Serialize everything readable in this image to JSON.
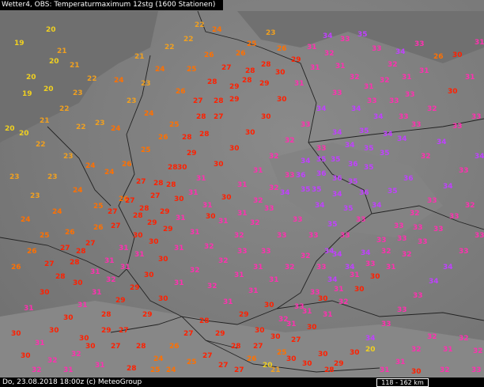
{
  "header": {
    "title": "Wetter4, OBS: Temperaturmaximum 12stg (1600 Stationen)"
  },
  "footer": {
    "timestamp": "Do, 23.08.2018 18:00z (c) MeteoGroup",
    "scale": "118 - 162 km"
  },
  "colors": {
    "temp_19_20": "#f0d020",
    "temp_21_23": "#f0a020",
    "temp_24_26": "#ff7000",
    "temp_27_30": "#ff2000",
    "temp_31_33": "#ff30b0",
    "temp_34_36": "#c040ff",
    "border": "#222222",
    "background": "#7a7a7a"
  },
  "stations": [
    [
      27,
      10,
      19
    ],
    [
      58,
      40,
      20
    ],
    [
      18,
      57,
      19
    ],
    [
      62,
      80,
      20
    ],
    [
      33,
      100,
      20
    ],
    [
      28,
      121,
      19
    ],
    [
      55,
      115,
      20
    ],
    [
      6,
      165,
      20
    ],
    [
      24,
      171,
      20
    ],
    [
      72,
      67,
      21
    ],
    [
      88,
      85,
      21
    ],
    [
      110,
      102,
      22
    ],
    [
      92,
      120,
      23
    ],
    [
      75,
      140,
      22
    ],
    [
      50,
      155,
      21
    ],
    [
      96,
      163,
      22
    ],
    [
      120,
      158,
      23
    ],
    [
      140,
      165,
      24
    ],
    [
      45,
      185,
      22
    ],
    [
      80,
      200,
      23
    ],
    [
      60,
      226,
      23
    ],
    [
      108,
      212,
      24
    ],
    [
      132,
      220,
      24
    ],
    [
      92,
      243,
      24
    ],
    [
      38,
      250,
      23
    ],
    [
      66,
      270,
      24
    ],
    [
      118,
      263,
      25
    ],
    [
      150,
      254,
      26
    ],
    [
      12,
      226,
      23
    ],
    [
      26,
      280,
      24
    ],
    [
      50,
      300,
      25
    ],
    [
      82,
      296,
      26
    ],
    [
      108,
      310,
      27
    ],
    [
      140,
      288,
      27
    ],
    [
      168,
      275,
      28
    ],
    [
      190,
      250,
      27
    ],
    [
      210,
      236,
      28
    ],
    [
      172,
      232,
      27
    ],
    [
      154,
      210,
      26
    ],
    [
      178,
      192,
      25
    ],
    [
      200,
      176,
      26
    ],
    [
      214,
      160,
      25
    ],
    [
      182,
      146,
      24
    ],
    [
      160,
      130,
      23
    ],
    [
      144,
      104,
      24
    ],
    [
      178,
      108,
      23
    ],
    [
      196,
      90,
      24
    ],
    [
      170,
      74,
      21
    ],
    [
      208,
      62,
      22
    ],
    [
      232,
      52,
      22
    ],
    [
      246,
      34,
      22
    ],
    [
      268,
      40,
      24
    ],
    [
      258,
      72,
      26
    ],
    [
      236,
      90,
      25
    ],
    [
      222,
      118,
      26
    ],
    [
      244,
      130,
      27
    ],
    [
      262,
      106,
      28
    ],
    [
      280,
      88,
      27
    ],
    [
      298,
      70,
      26
    ],
    [
      312,
      58,
      25
    ],
    [
      336,
      44,
      23
    ],
    [
      350,
      64,
      26
    ],
    [
      330,
      84,
      28
    ],
    [
      306,
      104,
      28
    ],
    [
      290,
      128,
      29
    ],
    [
      270,
      150,
      27
    ],
    [
      252,
      172,
      28
    ],
    [
      236,
      196,
      29
    ],
    [
      224,
      214,
      30
    ],
    [
      248,
      228,
      31
    ],
    [
      270,
      210,
      30
    ],
    [
      290,
      190,
      30
    ],
    [
      310,
      170,
      30
    ],
    [
      330,
      150,
      30
    ],
    [
      350,
      128,
      30
    ],
    [
      372,
      108,
      31
    ],
    [
      392,
      88,
      31
    ],
    [
      410,
      70,
      32
    ],
    [
      430,
      52,
      33
    ],
    [
      452,
      46,
      35
    ],
    [
      470,
      64,
      33
    ],
    [
      490,
      84,
      32
    ],
    [
      508,
      100,
      31
    ],
    [
      530,
      92,
      31
    ],
    [
      548,
      74,
      26
    ],
    [
      572,
      72,
      30
    ],
    [
      600,
      56,
      31
    ],
    [
      588,
      100,
      31
    ],
    [
      566,
      118,
      30
    ],
    [
      540,
      140,
      32
    ],
    [
      520,
      160,
      33
    ],
    [
      502,
      178,
      34
    ],
    [
      480,
      196,
      35
    ],
    [
      460,
      214,
      35
    ],
    [
      440,
      232,
      35
    ],
    [
      420,
      248,
      34
    ],
    [
      398,
      262,
      34
    ],
    [
      380,
      242,
      35
    ],
    [
      400,
      222,
      36
    ],
    [
      418,
      204,
      35
    ],
    [
      436,
      186,
      34
    ],
    [
      454,
      168,
      35
    ],
    [
      472,
      150,
      34
    ],
    [
      492,
      130,
      33
    ],
    [
      512,
      122,
      33
    ],
    [
      532,
      200,
      32
    ],
    [
      552,
      182,
      34
    ],
    [
      572,
      162,
      33
    ],
    [
      596,
      150,
      33
    ],
    [
      600,
      200,
      34
    ],
    [
      580,
      218,
      33
    ],
    [
      560,
      238,
      34
    ],
    [
      540,
      256,
      33
    ],
    [
      518,
      272,
      32
    ],
    [
      498,
      288,
      33
    ],
    [
      476,
      306,
      33
    ],
    [
      456,
      322,
      34
    ],
    [
      436,
      340,
      34
    ],
    [
      414,
      356,
      34
    ],
    [
      392,
      372,
      33
    ],
    [
      372,
      390,
      33
    ],
    [
      352,
      406,
      32
    ],
    [
      334,
      388,
      30
    ],
    [
      314,
      370,
      31
    ],
    [
      296,
      350,
      31
    ],
    [
      276,
      332,
      32
    ],
    [
      258,
      314,
      32
    ],
    [
      240,
      296,
      31
    ],
    [
      222,
      278,
      31
    ],
    [
      206,
      292,
      29
    ],
    [
      188,
      308,
      30
    ],
    [
      170,
      324,
      31
    ],
    [
      152,
      340,
      31
    ],
    [
      134,
      356,
      32
    ],
    [
      116,
      372,
      31
    ],
    [
      98,
      388,
      31
    ],
    [
      80,
      404,
      30
    ],
    [
      62,
      420,
      30
    ],
    [
      44,
      436,
      31
    ],
    [
      26,
      452,
      30
    ],
    [
      14,
      424,
      30
    ],
    [
      30,
      392,
      31
    ],
    [
      50,
      372,
      30
    ],
    [
      70,
      352,
      28
    ],
    [
      88,
      334,
      28
    ],
    [
      14,
      340,
      26
    ],
    [
      34,
      320,
      26
    ],
    [
      56,
      336,
      27
    ],
    [
      92,
      360,
      30
    ],
    [
      128,
      400,
      28
    ],
    [
      150,
      420,
      27
    ],
    [
      172,
      440,
      28
    ],
    [
      194,
      456,
      24
    ],
    [
      214,
      440,
      26
    ],
    [
      232,
      424,
      27
    ],
    [
      252,
      408,
      28
    ],
    [
      272,
      424,
      29
    ],
    [
      292,
      440,
      28
    ],
    [
      312,
      456,
      26
    ],
    [
      332,
      464,
      20
    ],
    [
      350,
      448,
      25
    ],
    [
      368,
      432,
      27
    ],
    [
      388,
      416,
      30
    ],
    [
      408,
      400,
      31
    ],
    [
      428,
      384,
      32
    ],
    [
      448,
      368,
      30
    ],
    [
      468,
      352,
      30
    ],
    [
      488,
      340,
      31
    ],
    [
      508,
      324,
      32
    ],
    [
      528,
      308,
      33
    ],
    [
      548,
      292,
      33
    ],
    [
      568,
      276,
      33
    ],
    [
      588,
      262,
      32
    ],
    [
      600,
      300,
      33
    ],
    [
      580,
      320,
      33
    ],
    [
      560,
      340,
      34
    ],
    [
      542,
      358,
      34
    ],
    [
      522,
      376,
      33
    ],
    [
      502,
      394,
      33
    ],
    [
      482,
      412,
      33
    ],
    [
      462,
      430,
      34
    ],
    [
      442,
      448,
      30
    ],
    [
      422,
      462,
      29
    ],
    [
      402,
      450,
      30
    ],
    [
      382,
      462,
      30
    ],
    [
      362,
      456,
      30
    ],
    [
      462,
      444,
      20
    ],
    [
      500,
      460,
      31
    ],
    [
      520,
      444,
      32
    ],
    [
      540,
      428,
      32
    ],
    [
      560,
      444,
      31
    ],
    [
      580,
      430,
      32
    ],
    [
      598,
      446,
      32
    ],
    [
      596,
      470,
      33
    ],
    [
      556,
      470,
      32
    ],
    [
      520,
      472,
      30
    ],
    [
      480,
      470,
      31
    ],
    [
      410,
      470,
      28
    ],
    [
      160,
      468,
      28
    ],
    [
      120,
      464,
      31
    ],
    [
      90,
      450,
      32
    ],
    [
      60,
      458,
      32
    ],
    [
      100,
      430,
      30
    ],
    [
      140,
      440,
      27
    ],
    [
      180,
      400,
      29
    ],
    [
      200,
      380,
      30
    ],
    [
      220,
      360,
      31
    ],
    [
      240,
      344,
      32
    ],
    [
      262,
      364,
      32
    ],
    [
      282,
      384,
      31
    ],
    [
      302,
      400,
      29
    ],
    [
      322,
      420,
      30
    ],
    [
      342,
      428,
      30
    ],
    [
      362,
      412,
      31
    ],
    [
      382,
      396,
      31
    ],
    [
      402,
      380,
      30
    ],
    [
      422,
      368,
      31
    ],
    [
      442,
      350,
      31
    ],
    [
      462,
      336,
      33
    ],
    [
      482,
      320,
      32
    ],
    [
      502,
      304,
      33
    ],
    [
      522,
      290,
      33
    ],
    [
      350,
      300,
      33
    ],
    [
      330,
      320,
      33
    ],
    [
      370,
      280,
      33
    ],
    [
      390,
      300,
      33
    ],
    [
      410,
      320,
      34
    ],
    [
      430,
      300,
      33
    ],
    [
      450,
      280,
      33
    ],
    [
      470,
      262,
      34
    ],
    [
      490,
      244,
      35
    ],
    [
      510,
      228,
      36
    ],
    [
      454,
      246,
      36
    ],
    [
      434,
      266,
      35
    ],
    [
      414,
      286,
      35
    ],
    [
      394,
      242,
      35
    ],
    [
      374,
      224,
      36
    ],
    [
      354,
      246,
      34
    ],
    [
      334,
      266,
      33
    ],
    [
      316,
      284,
      32
    ],
    [
      296,
      300,
      32
    ],
    [
      276,
      282,
      31
    ],
    [
      256,
      262,
      31
    ],
    [
      238,
      246,
      31
    ],
    [
      220,
      254,
      30
    ],
    [
      202,
      270,
      29
    ],
    [
      186,
      284,
      29
    ],
    [
      168,
      300,
      30
    ],
    [
      150,
      316,
      31
    ],
    [
      132,
      332,
      31
    ],
    [
      114,
      346,
      31
    ],
    [
      96,
      320,
      28
    ],
    [
      76,
      316,
      27
    ],
    [
      118,
      290,
      26
    ],
    [
      136,
      270,
      27
    ],
    [
      158,
      256,
      27
    ],
    [
      176,
      266,
      28
    ],
    [
      194,
      234,
      28
    ],
    [
      212,
      214,
      28
    ],
    [
      230,
      176,
      28
    ],
    [
      248,
      150,
      28
    ],
    [
      270,
      130,
      28
    ],
    [
      290,
      112,
      29
    ],
    [
      310,
      92,
      28
    ],
    [
      328,
      108,
      29
    ],
    [
      348,
      94,
      30
    ],
    [
      368,
      78,
      29
    ],
    [
      388,
      62,
      31
    ],
    [
      408,
      48,
      34
    ],
    [
      424,
      86,
      31
    ],
    [
      442,
      100,
      32
    ],
    [
      460,
      112,
      31
    ],
    [
      480,
      104,
      32
    ],
    [
      500,
      68,
      34
    ],
    [
      524,
      58,
      33
    ],
    [
      420,
      120,
      33
    ],
    [
      400,
      140,
      34
    ],
    [
      380,
      160,
      33
    ],
    [
      360,
      180,
      32
    ],
    [
      340,
      200,
      32
    ],
    [
      320,
      218,
      31
    ],
    [
      300,
      236,
      31
    ],
    [
      280,
      252,
      30
    ],
    [
      260,
      276,
      30
    ],
    [
      444,
      140,
      34
    ],
    [
      464,
      130,
      33
    ],
    [
      484,
      172,
      34
    ],
    [
      504,
      150,
      33
    ],
    [
      420,
      170,
      34
    ],
    [
      400,
      190,
      33
    ],
    [
      380,
      206,
      34
    ],
    [
      360,
      224,
      33
    ],
    [
      340,
      240,
      32
    ],
    [
      320,
      256,
      32
    ],
    [
      300,
      272,
      31
    ],
    [
      460,
      190,
      35
    ],
    [
      440,
      210,
      36
    ],
    [
      420,
      228,
      36
    ],
    [
      400,
      204,
      35
    ],
    [
      300,
      320,
      33
    ],
    [
      320,
      340,
      31
    ],
    [
      340,
      356,
      31
    ],
    [
      360,
      340,
      32
    ],
    [
      380,
      326,
      32
    ],
    [
      400,
      340,
      33
    ],
    [
      420,
      324,
      34
    ],
    [
      200,
      330,
      30
    ],
    [
      220,
      316,
      31
    ],
    [
      182,
      350,
      30
    ],
    [
      164,
      366,
      29
    ],
    [
      146,
      382,
      29
    ],
    [
      128,
      420,
      29
    ],
    [
      108,
      440,
      30
    ],
    [
      80,
      470,
      31
    ],
    [
      40,
      470,
      32
    ],
    [
      236,
      460,
      25
    ],
    [
      256,
      452,
      27
    ],
    [
      276,
      464,
      27
    ],
    [
      296,
      470,
      27
    ],
    [
      190,
      470,
      25
    ],
    [
      210,
      470,
      24
    ],
    [
      320,
      440,
      27
    ],
    [
      342,
      470,
      21
    ]
  ]
}
